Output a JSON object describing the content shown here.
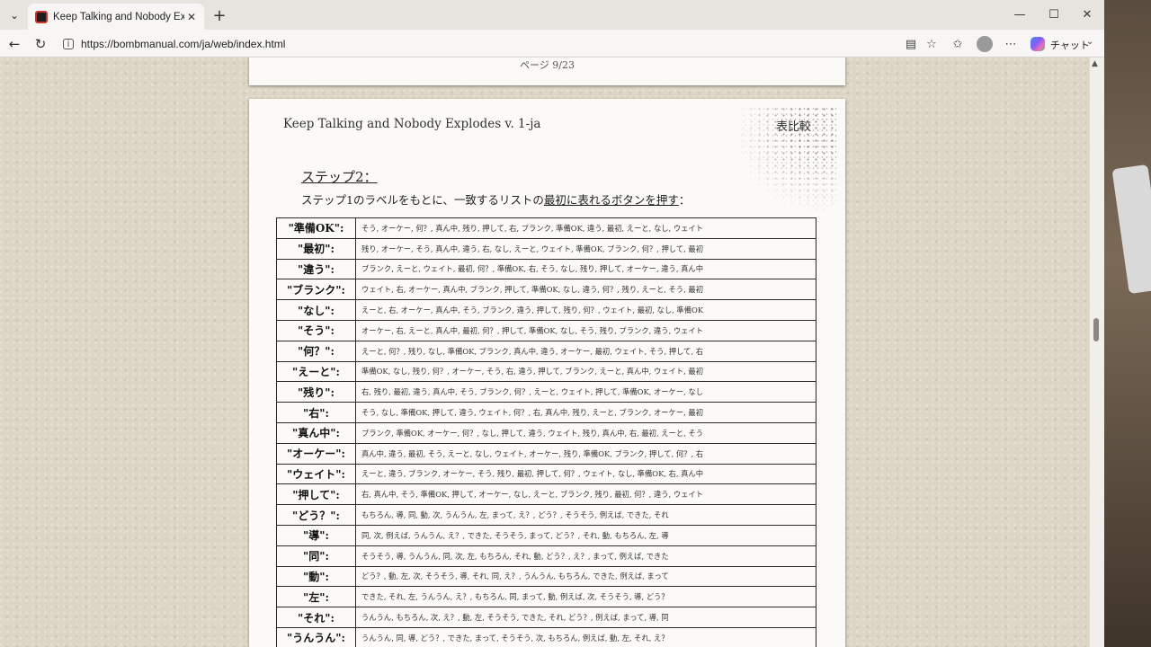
{
  "browser": {
    "tab_title": "Keep Talking and Nobody Explodes",
    "url": "https://bombmanual.com/ja/web/index.html",
    "chat_label": "チャット"
  },
  "manual": {
    "prev_page_number": "ページ 9/23",
    "doc_title": "Keep Talking and Nobody Explodes v. 1-ja",
    "section_title": "表比較",
    "step_heading": "ステップ2：",
    "instruction_pre": "ステップ1のラベルをもとに、一致するリストの",
    "instruction_underlined": "最初に表れるボタンを押す",
    "instruction_post": "：",
    "rows": [
      {
        "word": "\"準備OK\":",
        "list": "そう, オーケー, 何？, 真ん中, 残り, 押して, 右, ブランク, 準備OK, 違う, 最初, えーと, なし, ウェイト"
      },
      {
        "word": "\"最初\":",
        "list": "残り, オーケー, そう, 真ん中, 違う, 右, なし, えーと, ウェイト, 準備OK, ブランク, 何？, 押して, 最初"
      },
      {
        "word": "\"違う\":",
        "list": "ブランク, えーと, ウェイト, 最初, 何？, 準備OK, 右, そう, なし, 残り, 押して, オーケー, 違う, 真ん中"
      },
      {
        "word": "\"ブランク\":",
        "list": "ウェイト, 右, オーケー, 真ん中, ブランク, 押して, 準備OK, なし, 違う, 何？, 残り, えーと, そう, 最初"
      },
      {
        "word": "\"なし\":",
        "list": "えーと, 右, オーケー, 真ん中, そう, ブランク, 違う, 押して, 残り, 何？, ウェイト, 最初, なし, 準備OK"
      },
      {
        "word": "\"そう\":",
        "list": "オーケー, 右, えーと, 真ん中, 最初, 何？, 押して, 準備OK, なし, そう, 残り, ブランク, 違う, ウェイト"
      },
      {
        "word": "\"何？\":",
        "list": "えーと, 何？, 残り, なし, 準備OK, ブランク, 真ん中, 違う, オーケー, 最初, ウェイト, そう, 押して, 右"
      },
      {
        "word": "\"えーと\":",
        "list": "準備OK, なし, 残り, 何？, オーケー, そう, 右, 違う, 押して, ブランク, えーと, 真ん中, ウェイト, 最初"
      },
      {
        "word": "\"残り\":",
        "list": "右, 残り, 最初, 違う, 真ん中, そう, ブランク, 何？, えーと, ウェイト, 押して, 準備OK, オーケー, なし"
      },
      {
        "word": "\"右\":",
        "list": "そう, なし, 準備OK, 押して, 違う, ウェイト, 何？, 右, 真ん中, 残り, えーと, ブランク, オーケー, 最初"
      },
      {
        "word": "\"真ん中\":",
        "list": "ブランク, 準備OK, オーケー, 何？, なし, 押して, 違う, ウェイト, 残り, 真ん中, 右, 最初, えーと, そう"
      },
      {
        "word": "\"オーケー\":",
        "list": "真ん中, 違う, 最初, そう, えーと, なし, ウェイト, オーケー, 残り, 準備OK, ブランク, 押して, 何？, 右"
      },
      {
        "word": "\"ウェイト\":",
        "list": "えーと, 違う, ブランク, オーケー, そう, 残り, 最初, 押して, 何？, ウェイト, なし, 準備OK, 右, 真ん中"
      },
      {
        "word": "\"押して\":",
        "list": "右, 真ん中, そう, 準備OK, 押して, オーケー, なし, えーと, ブランク, 残り, 最初, 何？, 違う, ウェイト"
      },
      {
        "word": "\"どう？\":",
        "list": "もちろん, 導, 同, 動, 次, うんうん, 左, まって, え？, どう？, そうそう, 例えば, できた, それ"
      },
      {
        "word": "\"導\":",
        "list": "同, 次, 例えば, うんうん, え？, できた, そうそう, まって, どう？, それ, 動, もちろん, 左, 導"
      },
      {
        "word": "\"同\":",
        "list": "そうそう, 導, うんうん, 同, 次, 左, もちろん, それ, 動, どう？, え？, まって, 例えば, できた"
      },
      {
        "word": "\"動\":",
        "list": "どう？, 動, 左, 次, そうそう, 導, それ, 同, え？, うんうん, もちろん, できた, 例えば, まって"
      },
      {
        "word": "\"左\":",
        "list": "できた, それ, 左, うんうん, え？, もちろん, 同, まって, 動, 例えば, 次, そうそう, 導, どう？"
      },
      {
        "word": "\"それ\":",
        "list": "うんうん, もちろん, 次, え？, 動, 左, そうそう, できた, それ, どう？, 例えば, まって, 導, 同"
      },
      {
        "word": "\"うんうん\":",
        "list": "うんうん, 同, 導, どう？, できた, まって, そうそう, 次, もちろん, 例えば, 動, 左, それ, え？"
      }
    ]
  }
}
